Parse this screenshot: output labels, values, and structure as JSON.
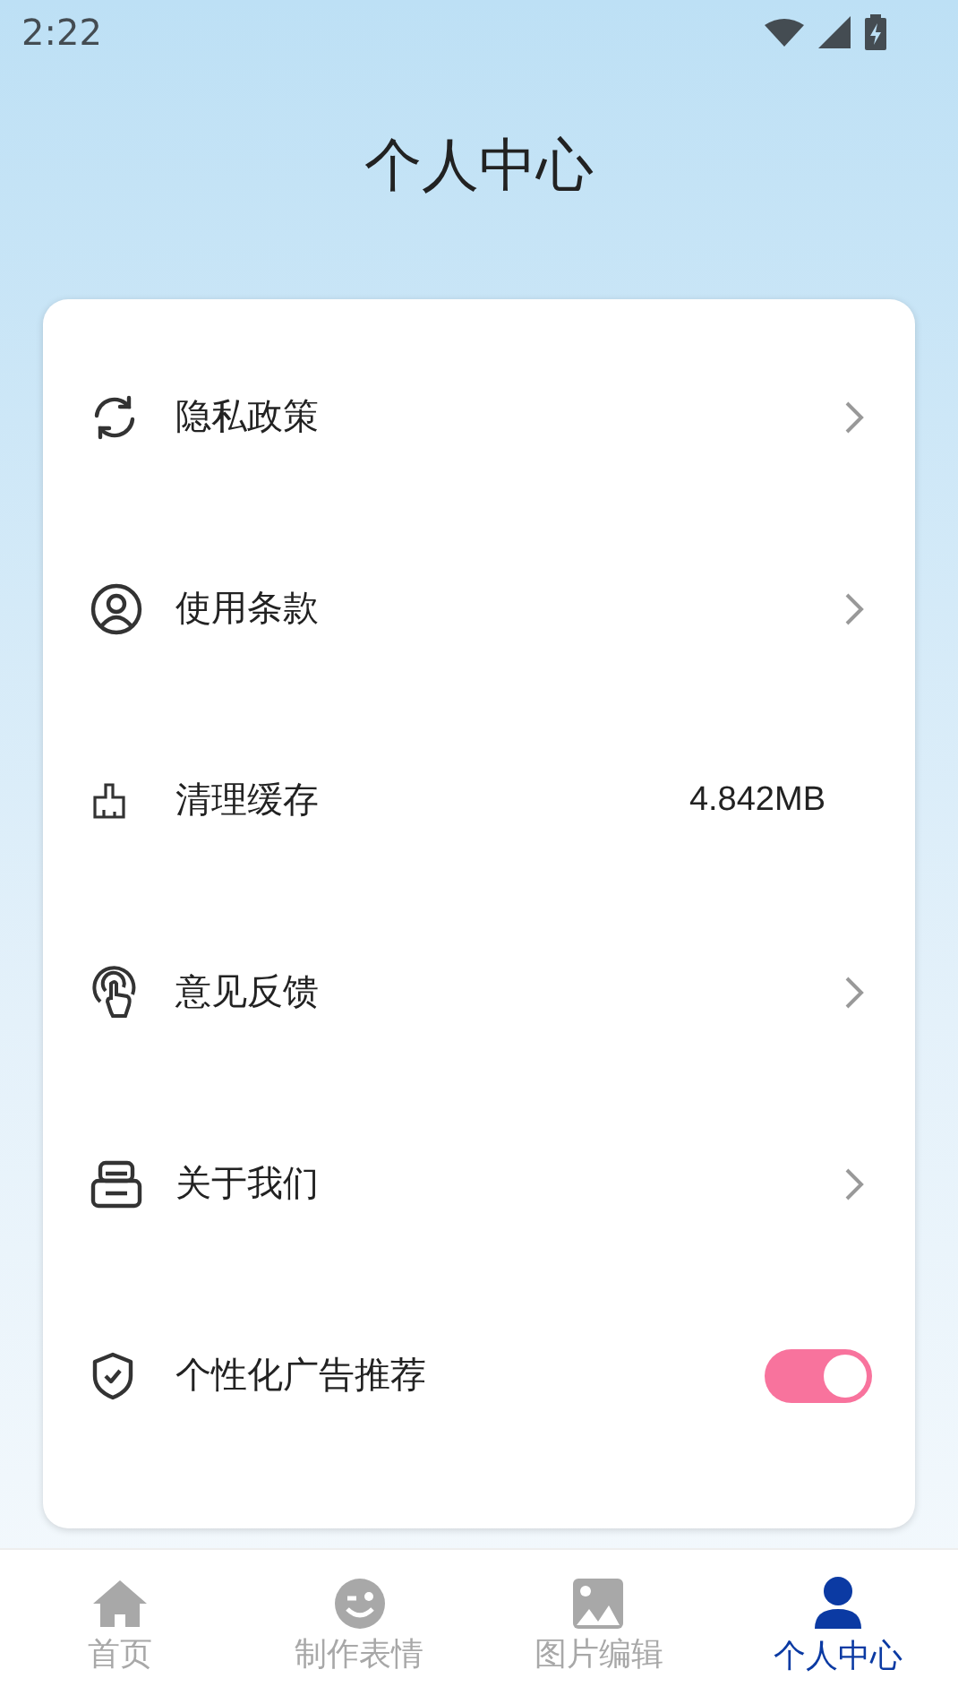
{
  "status_bar": {
    "time": "2:22"
  },
  "title": "个人中心",
  "menu": [
    {
      "kind": "link",
      "label": "隐私政策"
    },
    {
      "kind": "link",
      "label": "使用条款"
    },
    {
      "kind": "value",
      "label": "清理缓存",
      "value": "4.842MB"
    },
    {
      "kind": "link",
      "label": "意见反馈"
    },
    {
      "kind": "link",
      "label": "关于我们"
    },
    {
      "kind": "toggle",
      "label": "个性化广告推荐",
      "on": true
    }
  ],
  "tabs": [
    {
      "label": "首页",
      "selected": false
    },
    {
      "label": "制作表情",
      "selected": false
    },
    {
      "label": "图片编辑",
      "selected": false
    },
    {
      "label": "个人中心",
      "selected": true
    }
  ]
}
